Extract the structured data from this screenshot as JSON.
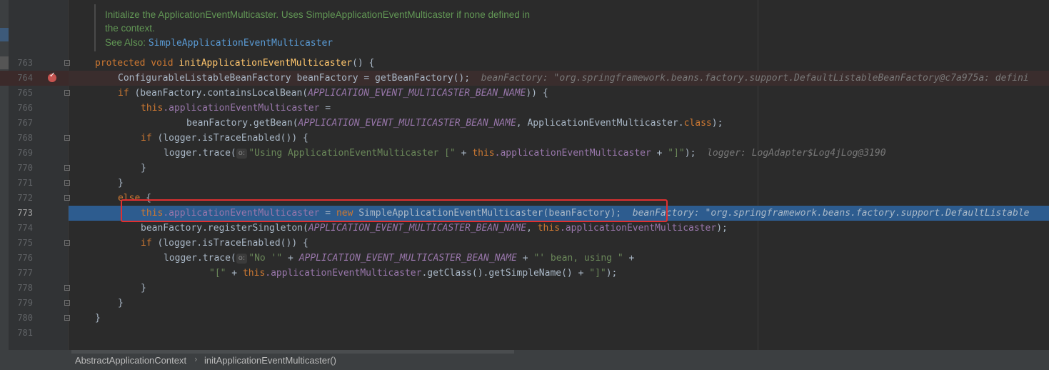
{
  "doc": {
    "line1": "Initialize the ApplicationEventMulticaster. Uses SimpleApplicationEventMulticaster if none defined in",
    "line2": "the context.",
    "see_also_label": "See Also:",
    "see_also_link": "SimpleApplicationEventMulticaster"
  },
  "lines": [
    {
      "num": "763"
    },
    {
      "num": "764"
    },
    {
      "num": "765"
    },
    {
      "num": "766"
    },
    {
      "num": "767"
    },
    {
      "num": "768"
    },
    {
      "num": "769"
    },
    {
      "num": "770"
    },
    {
      "num": "771"
    },
    {
      "num": "772"
    },
    {
      "num": "773"
    },
    {
      "num": "774"
    },
    {
      "num": "775"
    },
    {
      "num": "776"
    },
    {
      "num": "777"
    },
    {
      "num": "778"
    },
    {
      "num": "779"
    },
    {
      "num": "780"
    },
    {
      "num": "781"
    }
  ],
  "code": {
    "l763": {
      "kw1": "protected",
      "kw2": "void",
      "fn": "initApplicationEventMulticaster",
      "rest": "() {"
    },
    "l764": {
      "text": "ConfigurableListableBeanFactory beanFactory = getBeanFactory();",
      "hint": "beanFactory: \"org.springframework.beans.factory.support.DefaultListableBeanFactory@c7a975a: defini"
    },
    "l765": {
      "kw": "if",
      "pre": " (beanFactory.containsLocalBean(",
      "const": "APPLICATION_EVENT_MULTICASTER_BEAN_NAME",
      "post": ")) {"
    },
    "l766": {
      "kw": "this",
      "fld": ".applicationEventMulticaster",
      "post": " ="
    },
    "l767": {
      "pre": "beanFactory.getBean(",
      "const": "APPLICATION_EVENT_MULTICASTER_BEAN_NAME",
      "mid": ", ApplicationEventMulticaster.",
      "kw": "class",
      "post": ");"
    },
    "l768": {
      "kw": "if",
      "post": " (logger.isTraceEnabled()) {"
    },
    "l769": {
      "pre": "logger.trace(",
      "ph": "o:",
      "str": "\"Using ApplicationEventMulticaster [\"",
      "mid": " + ",
      "kw": "this",
      "fld": ".applicationEventMulticaster",
      "post": " + ",
      "str2": "\"]\"",
      "end": ");",
      "hint": "logger: LogAdapter$Log4jLog@3190"
    },
    "l770": {
      "text": "}"
    },
    "l771": {
      "text": "}"
    },
    "l772": {
      "kw": "else",
      "post": " {"
    },
    "l773": {
      "kw": "this",
      "fld": ".applicationEventMulticaster",
      "mid": " = ",
      "kw2": "new",
      "post": " SimpleApplicationEventMulticaster(beanFactory);",
      "hint": "beanFactory: \"org.springframework.beans.factory.support.DefaultListable"
    },
    "l774": {
      "pre": "beanFactory.registerSingleton(",
      "const": "APPLICATION_EVENT_MULTICASTER_BEAN_NAME",
      "mid": ", ",
      "kw": "this",
      "fld": ".applicationEventMulticaster",
      "post": ");"
    },
    "l775": {
      "kw": "if",
      "post": " (logger.isTraceEnabled()) {"
    },
    "l776": {
      "pre": "logger.trace(",
      "ph": "o:",
      "str": "\"No '\"",
      "mid": " + ",
      "const": "APPLICATION_EVENT_MULTICASTER_BEAN_NAME",
      "mid2": " + ",
      "str2": "\"' bean, using \"",
      "post": " +"
    },
    "l777": {
      "str": "\"[\"",
      "mid": " + ",
      "kw": "this",
      "fld": ".applicationEventMulticaster",
      "post": ".getClass().getSimpleName() + ",
      "str2": "\"]\"",
      "end": ");"
    },
    "l778": {
      "text": "}"
    },
    "l779": {
      "text": "}"
    },
    "l780": {
      "text": "}"
    },
    "l781": {
      "text": ""
    }
  },
  "breadcrumb": {
    "class_name": "AbstractApplicationContext",
    "separator": "›",
    "method_name": "initApplicationEventMulticaster()"
  },
  "colors": {
    "keyword": "#cc7832",
    "function": "#ffc66d",
    "field": "#9876aa",
    "string": "#6a8759",
    "current_line": "#2d5c8f",
    "highlight_box": "#e03030"
  }
}
